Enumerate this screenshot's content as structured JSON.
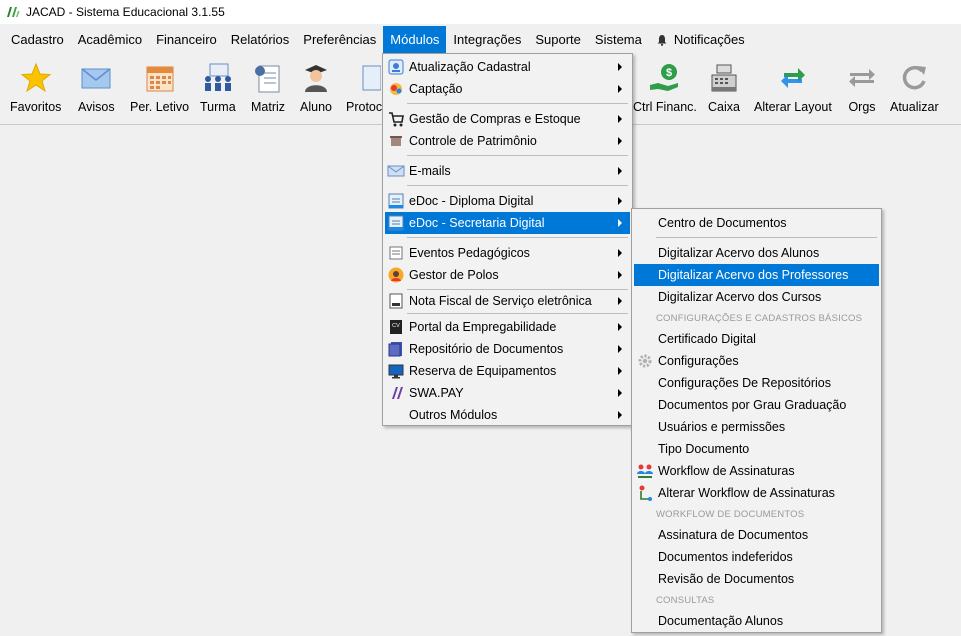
{
  "window": {
    "title": "JACAD - Sistema Educacional 3.1.55"
  },
  "menubar": {
    "cadastro": "Cadastro",
    "academico": "Acadêmico",
    "financeiro": "Financeiro",
    "relatorios": "Relatórios",
    "preferencias": "Preferências",
    "modulos": "Módulos",
    "integracoes": "Integrações",
    "suporte": "Suporte",
    "sistema": "Sistema",
    "notificacoes": "Notificações"
  },
  "toolbar": {
    "favoritos": "Favoritos",
    "avisos": "Avisos",
    "per_letivo": "Per. Letivo",
    "turma": "Turma",
    "matriz": "Matriz",
    "aluno": "Aluno",
    "protocolo": "Protoc",
    "ctrl_financ": "Ctrl Financ.",
    "caixa": "Caixa",
    "alterar_layout": "Alterar Layout",
    "orgs": "Orgs",
    "atualizar": "Atualizar"
  },
  "modulos_menu": {
    "atualizacao_cadastral": "Atualização Cadastral",
    "captacao": "Captação",
    "gestao_compras": "Gestão de Compras e Estoque",
    "controle_patrimonio": "Controle de Patrimônio",
    "emails": "E-mails",
    "edoc_diploma": "eDoc - Diploma Digital",
    "edoc_secretaria": "eDoc - Secretaria Digital",
    "eventos_pedagogicos": "Eventos Pedagógicos",
    "gestor_polos": "Gestor de Polos",
    "nota_fiscal": "Nota Fiscal de Serviço eletrônica",
    "portal_empregabilidade": "Portal da Empregabilidade",
    "repositorio_documentos": "Repositório de Documentos",
    "reserva_equipamentos": "Reserva de Equipamentos",
    "swa_pay": "SWA.PAY",
    "outros_modulos": "Outros Módulos"
  },
  "secretaria_submenu": {
    "centro_documentos": "Centro de Documentos",
    "digitalizar_alunos": "Digitalizar Acervo dos Alunos",
    "digitalizar_professores": "Digitalizar Acervo dos Professores",
    "digitalizar_cursos": "Digitalizar Acervo dos Cursos",
    "hdr_configuracoes": "CONFIGURAÇÕES E CADASTROS BÁSICOS",
    "certificado_digital": "Certificado Digital",
    "configuracoes": "Configurações",
    "config_repositorios": "Configurações De Repositórios",
    "docs_grau_graduacao": "Documentos por Grau Graduação",
    "usuarios_permissoes": "Usuários e permissões",
    "tipo_documento": "Tipo Documento",
    "workflow_assinaturas": "Workflow de Assinaturas",
    "alterar_workflow": "Alterar Workflow de Assinaturas",
    "hdr_workflow": "WORKFLOW DE DOCUMENTOS",
    "assinatura_documentos": "Assinatura de Documentos",
    "documentos_indeferidos": "Documentos indeferidos",
    "revisao_documentos": "Revisão de Documentos",
    "hdr_consultas": "CONSULTAS",
    "documentacao_alunos": "Documentação Alunos"
  },
  "icons": {
    "favoritos": "star-icon",
    "avisos": "envelope-icon",
    "per_letivo": "calendar-icon",
    "turma": "class-icon",
    "matriz": "matrix-icon",
    "aluno": "student-icon",
    "protocolo": "protocol-icon",
    "ctrl_financ": "money-hand-icon",
    "caixa": "cash-register-icon",
    "alterar_layout": "swap-arrows-icon",
    "orgs": "orgs-arrows-icon",
    "atualizar": "refresh-icon"
  },
  "colors": {
    "highlight": "#0078d7",
    "menu_bg": "#f2f2f2",
    "window_bg": "#f0f0f0"
  }
}
